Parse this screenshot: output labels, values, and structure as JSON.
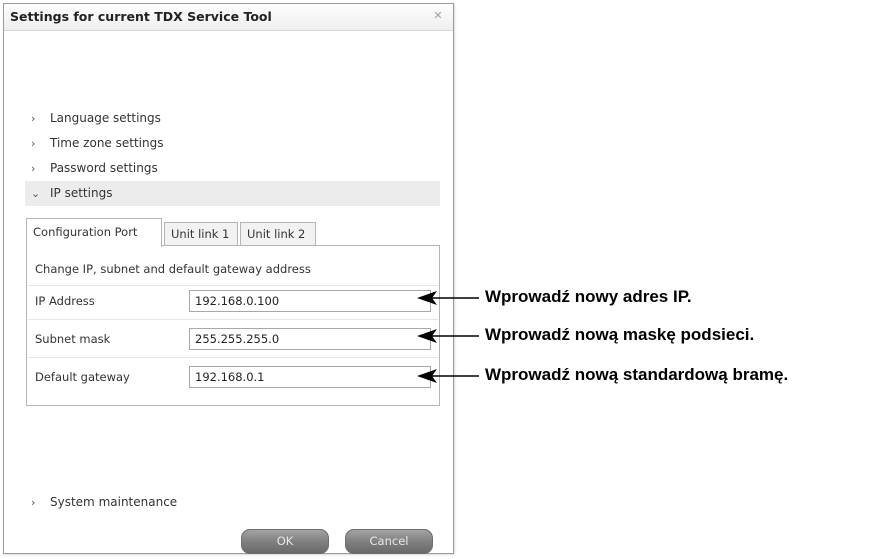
{
  "dialog": {
    "title": "Settings for current TDX Service Tool",
    "close_icon": "close-icon"
  },
  "sections": [
    {
      "label": "Language settings",
      "expanded": false
    },
    {
      "label": "Time zone settings",
      "expanded": false
    },
    {
      "label": "Password settings",
      "expanded": false
    },
    {
      "label": "IP settings",
      "expanded": true
    },
    {
      "label": "System maintenance",
      "expanded": false
    }
  ],
  "icons": {
    "collapsed": "chevron-right-icon",
    "expanded": "chevron-down-icon",
    "collapsed_glyph": "›",
    "expanded_glyph": "⌄"
  },
  "tabs": [
    {
      "label": "Configuration Port",
      "active": true
    },
    {
      "label": "Unit link 1",
      "active": false
    },
    {
      "label": "Unit link 2",
      "active": false
    }
  ],
  "panel": {
    "heading": "Change IP, subnet and default gateway address",
    "fields": [
      {
        "label": "IP Address",
        "value": "192.168.0.100"
      },
      {
        "label": "Subnet mask",
        "value": "255.255.255.0"
      },
      {
        "label": "Default gateway",
        "value": "192.168.0.1"
      }
    ]
  },
  "buttons": {
    "ok": "OK",
    "cancel": "Cancel"
  },
  "annotations": [
    "Wprowadź nowy adres IP.",
    "Wprowadź nową maskę podsieci.",
    "Wprowadź nową standardową bramę."
  ],
  "colors": {
    "button_gradient_top": "#a3a3a3",
    "button_gradient_bottom": "#6a6a6a",
    "expanded_section_bg": "#ececec"
  }
}
